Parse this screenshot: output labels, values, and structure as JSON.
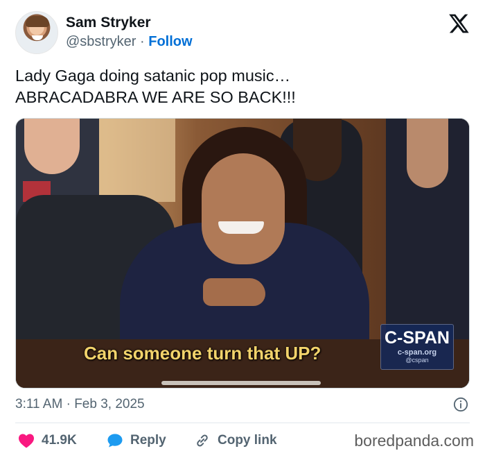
{
  "author": {
    "name": "Sam Stryker",
    "handle": "@sbstryker",
    "separator": "·",
    "follow_label": "Follow"
  },
  "tweet": {
    "lines": [
      "Lady Gaga doing satanic pop music…",
      "ABRACADABRA WE ARE SO BACK!!!"
    ]
  },
  "media": {
    "caption": "Can someone turn that UP?",
    "network_logo": "C-SPAN",
    "network_url": "c-span.org",
    "network_handle": "@cspan"
  },
  "meta": {
    "time": "3:11 AM",
    "separator": "·",
    "date": "Feb 3, 2025"
  },
  "actions": {
    "likes": "41.9K",
    "reply_label": "Reply",
    "copy_label": "Copy link"
  },
  "watermark": "boredpanda.com",
  "colors": {
    "accent": "#006fd6",
    "like": "#f91880",
    "reply": "#1d9bf0",
    "caption": "#f2d36b"
  },
  "icons": {
    "logo": "x-logo-icon",
    "info": "info-icon",
    "like": "heart-icon",
    "reply": "speech-bubble-icon",
    "copy": "link-icon"
  }
}
